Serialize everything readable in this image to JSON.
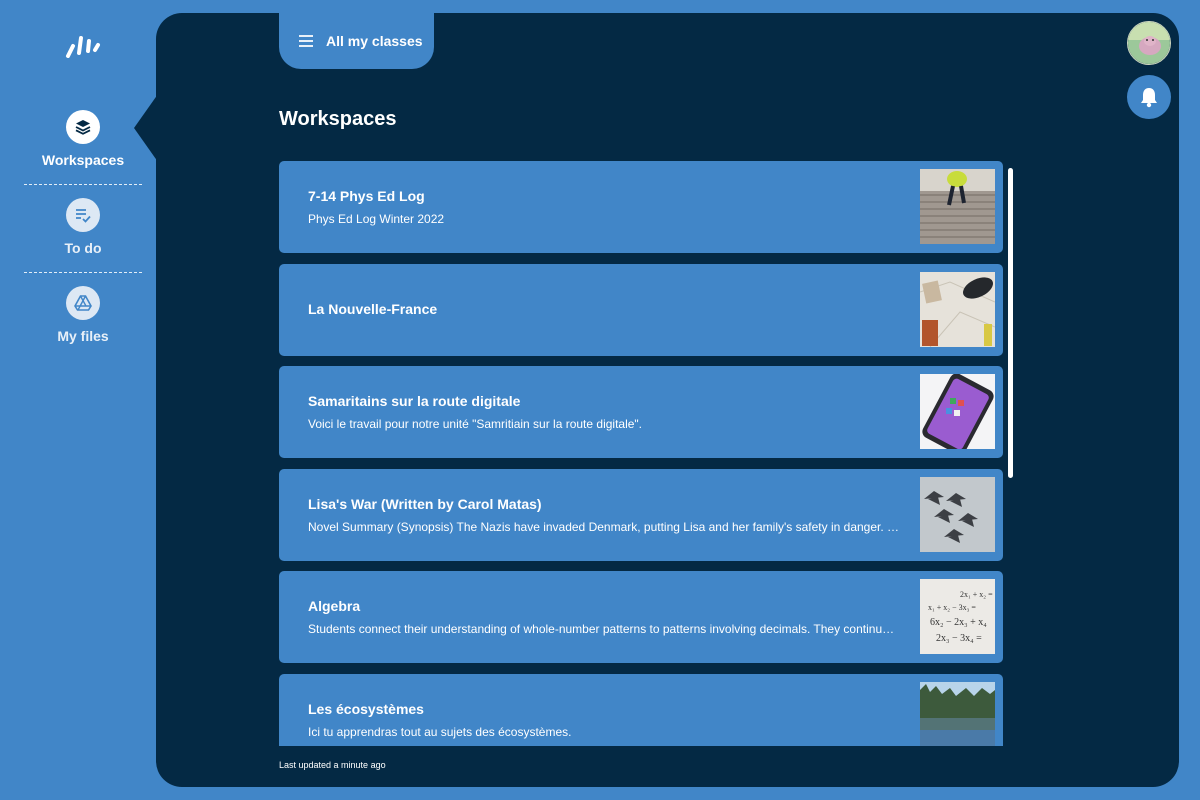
{
  "sidebar": {
    "items": [
      {
        "label": "Workspaces",
        "icon": "layers-icon"
      },
      {
        "label": "To do",
        "icon": "checklist-icon"
      },
      {
        "label": "My files",
        "icon": "drive-icon"
      }
    ]
  },
  "header": {
    "classes_label": "All my classes",
    "page_title": "Workspaces"
  },
  "workspaces": [
    {
      "title": "7-14 Phys Ed Log",
      "description": "Phys Ed Log Winter 2022",
      "thumb": "running-stairs-image"
    },
    {
      "title": "La Nouvelle-France",
      "description": "",
      "thumb": "map-desk-image"
    },
    {
      "title": "Samaritains sur la route digitale",
      "description": "Voici le travail pour notre unité \"Samritiain sur la route digitale\".",
      "thumb": "smartphone-image"
    },
    {
      "title": "Lisa's War (Written by Carol Matas)",
      "description": "Novel Summary (Synopsis) The Nazis have invaded Denmark, putting Lisa and her family's safety in danger. But she is determined to help the resistance",
      "thumb": "fighter-jets-image"
    },
    {
      "title": "Algebra",
      "description": "Students connect their understanding of whole-number patterns to patterns involving decimals. They continue to develop algebraic reasoning",
      "thumb": "equations-image"
    },
    {
      "title": "Les écosystèmes",
      "description": "Ici tu apprendras tout au sujets des écosystèmes.",
      "thumb": "lake-forest-image"
    }
  ],
  "footer": {
    "status": "Last updated a minute ago"
  },
  "colors": {
    "accent": "#4186c8",
    "panel": "#042944"
  }
}
